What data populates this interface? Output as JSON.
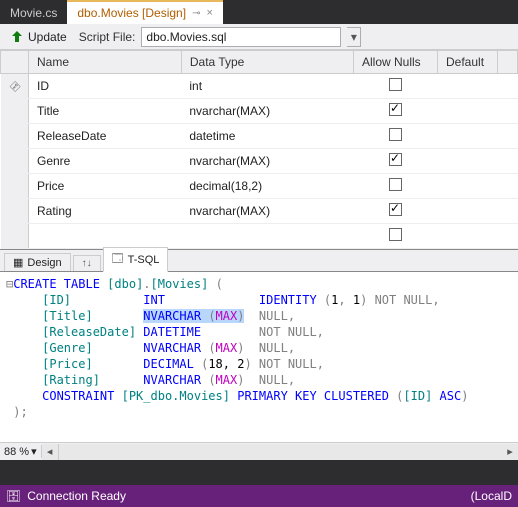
{
  "tabs": {
    "inactive": "Movie.cs",
    "active": "dbo.Movies [Design]"
  },
  "toolbar": {
    "update_label": "Update",
    "script_file_label": "Script File:",
    "script_file_value": "dbo.Movies.sql"
  },
  "grid": {
    "headers": {
      "name": "Name",
      "datatype": "Data Type",
      "allownulls": "Allow Nulls",
      "default": "Default"
    },
    "rows": [
      {
        "key": true,
        "name": "ID",
        "type": "int",
        "nullable": false
      },
      {
        "key": false,
        "name": "Title",
        "type": "nvarchar(MAX)",
        "nullable": true
      },
      {
        "key": false,
        "name": "ReleaseDate",
        "type": "datetime",
        "nullable": false
      },
      {
        "key": false,
        "name": "Genre",
        "type": "nvarchar(MAX)",
        "nullable": true
      },
      {
        "key": false,
        "name": "Price",
        "type": "decimal(18,2)",
        "nullable": false
      },
      {
        "key": false,
        "name": "Rating",
        "type": "nvarchar(MAX)",
        "nullable": true
      }
    ]
  },
  "lower_tabs": {
    "design": "Design",
    "tsql": "T-SQL"
  },
  "sql": {
    "create": "CREATE TABLE",
    "schema": "[dbo]",
    "table": "[Movies]",
    "cols": [
      {
        "name": "[ID]",
        "type": "INT",
        "max": "",
        "extra_kw": "IDENTITY",
        "extra_args": "(1, 1)",
        "null": "NOT NULL"
      },
      {
        "name": "[Title]",
        "type": "NVARCHAR",
        "max": "(MAX)",
        "extra_kw": "",
        "extra_args": "",
        "null": "NULL",
        "hl": true
      },
      {
        "name": "[ReleaseDate]",
        "type": "DATETIME",
        "max": "",
        "extra_kw": "",
        "extra_args": "",
        "null": "NOT NULL"
      },
      {
        "name": "[Genre]",
        "type": "NVARCHAR",
        "max": "(MAX)",
        "extra_kw": "",
        "extra_args": "",
        "null": "NULL"
      },
      {
        "name": "[Price]",
        "type": "DECIMAL",
        "max": "(18, 2)",
        "extra_kw": "",
        "extra_args": "",
        "null": "NOT NULL"
      },
      {
        "name": "[Rating]",
        "type": "NVARCHAR",
        "max": "(MAX)",
        "extra_kw": "",
        "extra_args": "",
        "null": "NULL"
      }
    ],
    "constraint_kw": "CONSTRAINT",
    "constraint_name": "[PK_dbo.Movies]",
    "pk_kw": "PRIMARY KEY CLUSTERED",
    "pk_col": "([ID]",
    "asc_kw": "ASC",
    "close": ")"
  },
  "zoom": "88 %",
  "status": {
    "text": "Connection Ready",
    "right": "(LocalD"
  }
}
